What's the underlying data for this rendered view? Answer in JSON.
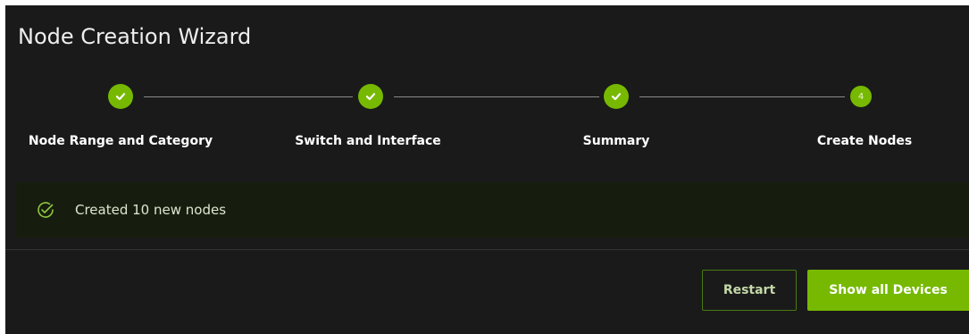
{
  "wizard": {
    "title": "Node Creation Wizard",
    "steps": [
      {
        "label": "Node Range and Category",
        "status": "completed",
        "icon": "check-icon"
      },
      {
        "label": "Switch and Interface",
        "status": "completed",
        "icon": "check-icon"
      },
      {
        "label": "Summary",
        "status": "completed",
        "icon": "check-icon"
      },
      {
        "label": "Create Nodes",
        "status": "current",
        "number": "4"
      }
    ]
  },
  "alert": {
    "icon": "check-circle-icon",
    "message": "Created 10 new nodes"
  },
  "footer": {
    "restart_label": "Restart",
    "show_all_label": "Show all Devices"
  },
  "colors": {
    "accent": "#76b900",
    "background": "#1a1a1a",
    "alert_background": "#171d0e"
  }
}
